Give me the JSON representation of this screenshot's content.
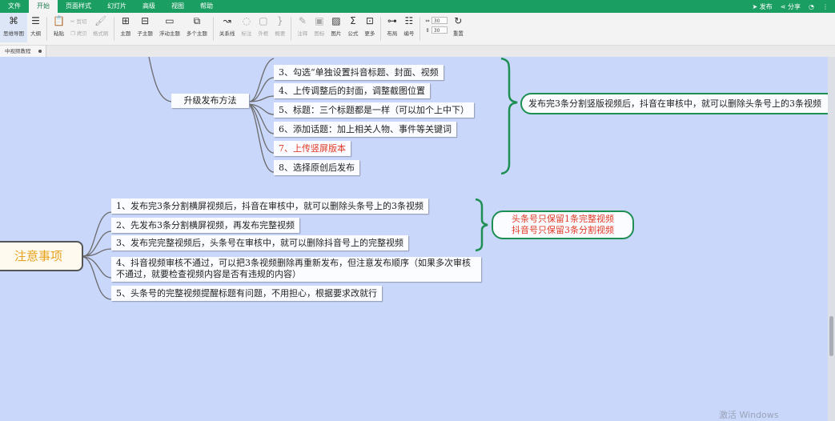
{
  "menu": {
    "items": [
      "文件",
      "开始",
      "页面样式",
      "幻灯片",
      "高级",
      "视图",
      "帮助"
    ],
    "active_index": 1,
    "right": {
      "publish": "发布",
      "share": "分享"
    }
  },
  "toolbar": {
    "mindmap_mode": "思维导图",
    "outline": "大纲",
    "paste": "粘贴",
    "cut": "剪切",
    "copy": "拷贝",
    "format_painter": "格式刷",
    "topic": "主题",
    "subtopic": "子主题",
    "float_topic": "浮动主题",
    "multi_topic": "多个主题",
    "relation": "关系线",
    "label": "标注",
    "outline_box": "外框",
    "summary": "概要",
    "note": "注释",
    "icon": "图标",
    "image": "图片",
    "formula": "公式",
    "more": "更多",
    "layout": "布局",
    "numbering": "编号",
    "spacing1": "30",
    "spacing2": "30",
    "reset": "重置"
  },
  "tab": {
    "label": "中视频教程"
  },
  "mindmap": {
    "upgrade_label": "升级发布方法",
    "upgrade_steps": [
      "3、勾选“单独设置抖音标题、封面、视频",
      "4、上传调整后的封面，调整截图位置",
      "5、标题：三个标题都是一样（可以加个上中下）",
      "6、添加话题：加上相关人物、事件等关键词",
      "7、上传竖屏版本",
      "8、选择原创后发布"
    ],
    "upgrade_summary": "发布完3条分割竖版视频后，抖音在审核中，就可以删除头条号上的3条视频",
    "root": "注意事项",
    "notes": [
      "1、发布完3条分割横屏视频后，抖音在审核中，就可以删除头条号上的3条视频",
      "2、先发布3条分割横屏视频，再发布完整视频",
      "3、发布完完整视频后，头条号在审核中，就可以删除抖音号上的完整视频",
      "4、抖音视频审核不通过，可以把3条视频删除再重新发布，但注意发布顺序（如果多次审核不通过，就要检查视频内容是否有违规的内容）",
      "5、头条号的完整视频提醒标题有问题，不用担心，根据要求改就行"
    ],
    "notes_summary": [
      "头条号只保留1条完整视频",
      "抖音号只保留3条分割视频"
    ]
  },
  "watermark": "激活 Windows",
  "colors": {
    "menubar": "#1b9e62",
    "canvas": "#c9d7fa",
    "branch": "#6b6b6b",
    "brace": "#1e8f53",
    "highlight": "#e03a26",
    "root_text": "#e6a21d"
  }
}
